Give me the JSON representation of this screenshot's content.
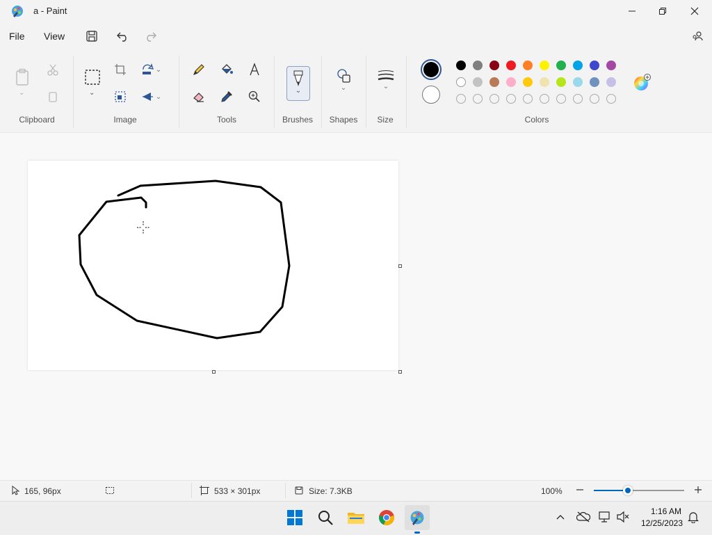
{
  "window": {
    "title": "a - Paint"
  },
  "menu": {
    "file": "File",
    "view": "View"
  },
  "ribbon": {
    "groups": {
      "clipboard": "Clipboard",
      "image": "Image",
      "tools": "Tools",
      "brushes": "Brushes",
      "shapes": "Shapes",
      "size": "Size",
      "colors": "Colors"
    }
  },
  "colors": {
    "primary": "#000000",
    "secondary": "#ffffff",
    "row1": [
      "#000000",
      "#7f7f7f",
      "#880015",
      "#ed1c24",
      "#ff7f27",
      "#fff200",
      "#22b14c",
      "#00a2e8",
      "#3f48cc",
      "#a349a4"
    ],
    "row2": [
      "#ffffff",
      "#c3c3c3",
      "#b97a57",
      "#ffaec9",
      "#ffc90e",
      "#efe4b0",
      "#b5e61d",
      "#99d9ea",
      "#7092be",
      "#c8bfe7"
    ],
    "row3": [
      "empty",
      "empty",
      "empty",
      "empty",
      "empty",
      "empty",
      "empty",
      "empty",
      "empty",
      "empty"
    ]
  },
  "status": {
    "cursor_pos": "165, 96px",
    "canvas_size": "533 × 301px",
    "file_size": "Size: 7.3KB",
    "zoom": "100%",
    "zoom_level": 0.38
  },
  "taskbar": {
    "time": "1:16 AM",
    "date": "12/25/2023"
  }
}
